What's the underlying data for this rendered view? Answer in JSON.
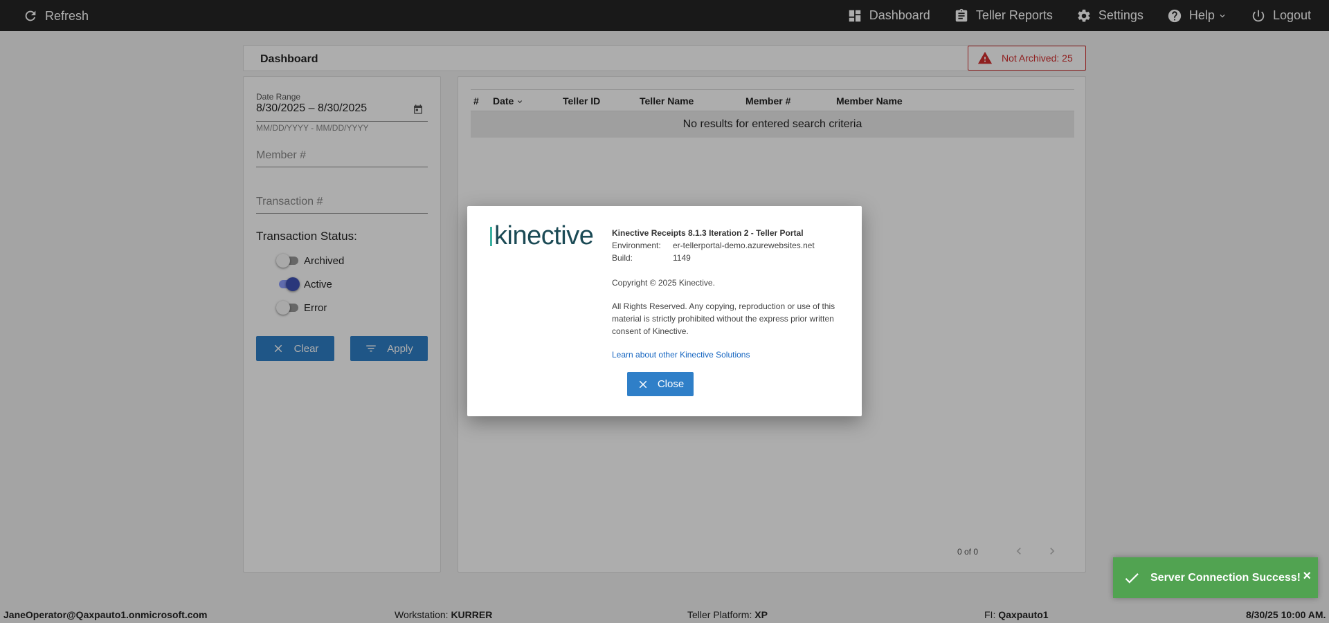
{
  "topbar": {
    "refresh_label": "Refresh",
    "dashboard_label": "Dashboard",
    "teller_reports_label": "Teller Reports",
    "settings_label": "Settings",
    "help_label": "Help",
    "logout_label": "Logout"
  },
  "dashboard": {
    "title": "Dashboard",
    "not_archived_label": "Not Archived: 25"
  },
  "filters": {
    "date_range_label": "Date Range",
    "date_range_value": "8/30/2025 – 8/30/2025",
    "date_format_hint": "MM/DD/YYYY - MM/DD/YYYY",
    "member_placeholder": "Member #",
    "transaction_placeholder": "Transaction #",
    "status_label": "Transaction Status:",
    "toggles": [
      {
        "label": "Archived",
        "on": false
      },
      {
        "label": "Active",
        "on": true
      },
      {
        "label": "Error",
        "on": false
      }
    ],
    "clear_label": "Clear",
    "apply_label": "Apply"
  },
  "table": {
    "columns": [
      "#",
      "Date",
      "Teller ID",
      "Teller Name",
      "Member #",
      "Member Name"
    ],
    "empty_message": "No results for entered search criteria",
    "pager_text": "0 of 0"
  },
  "about_dialog": {
    "logo_text": "kinective",
    "product_title": "Kinective Receipts 8.1.3 Iteration 2 - Teller Portal",
    "environment_label": "Environment:",
    "environment_value": "er-tellerportal-demo.azurewebsites.net",
    "build_label": "Build:",
    "build_value": "1149",
    "copyright": "Copyright © 2025 Kinective.",
    "rights": "All Rights Reserved. Any copying, reproduction or use of this material is strictly prohibited without the express prior written consent of Kinective.",
    "link_text": "Learn about other Kinective Solutions",
    "close_label": "Close"
  },
  "toast": {
    "message": "Server Connection Success!",
    "close_glyph": "×"
  },
  "footer": {
    "user": "JaneOperator@Qaxpauto1.onmicrosoft.com",
    "workstation_label": "Workstation:",
    "workstation_value": "KURRER",
    "platform_label": "Teller Platform:",
    "platform_value": "XP",
    "fi_label": "FI:",
    "fi_value": "Qaxpauto1",
    "datetime": "8/30/25 10:00 AM."
  },
  "colors": {
    "topbar_bg": "#262626",
    "primary_button": "#2f7fc8",
    "alert_red": "#d32f2f",
    "toast_green": "#51a351",
    "toggle_active": "#3f51b5"
  }
}
